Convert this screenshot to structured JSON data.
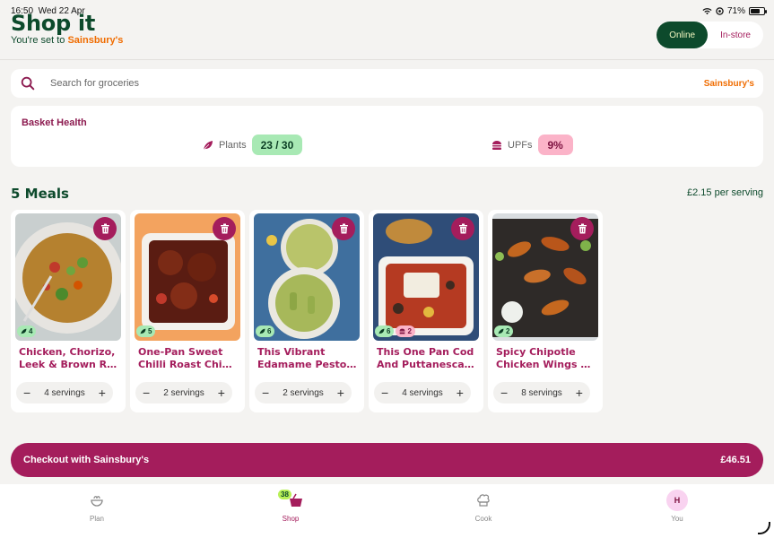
{
  "status": {
    "time": "16:50",
    "date": "Wed 22 Apr",
    "battery": "71%"
  },
  "header": {
    "title": "Shop it",
    "subtitle_prefix": "You're set to",
    "store": "Sainsbury's",
    "toggle": {
      "online": "Online",
      "instore": "In-store"
    }
  },
  "search": {
    "placeholder": "Search for groceries",
    "brand": "Sainsbury's"
  },
  "health": {
    "title": "Basket Health",
    "plants_label": "Plants",
    "plants_value": "23 / 30",
    "upfs_label": "UPFs",
    "upfs_value": "9%"
  },
  "meals": {
    "title": "5 Meals",
    "per_serving": "£2.15 per serving",
    "items": [
      {
        "name1": "Chicken, Chorizo,",
        "name2": "Leek & Brown Ri...",
        "plants": "4",
        "upf": "",
        "servings": "4 servings"
      },
      {
        "name1": "One-Pan Sweet",
        "name2": "Chilli Roast Chic...",
        "plants": "5",
        "upf": "",
        "servings": "2 servings"
      },
      {
        "name1": "This Vibrant",
        "name2": "Edamame Pesto ...",
        "plants": "6",
        "upf": "",
        "servings": "2 servings"
      },
      {
        "name1": "This One Pan Cod",
        "name2": "And Puttanesca ...",
        "plants": "6",
        "upf": "2",
        "servings": "4 servings"
      },
      {
        "name1": "Spicy Chipotle",
        "name2": "Chicken Wings w...",
        "plants": "2",
        "upf": "",
        "servings": "8 servings"
      }
    ]
  },
  "checkout": {
    "label": "Checkout with Sainsbury's",
    "total": "£46.51"
  },
  "tabs": {
    "plan": "Plan",
    "shop": "Shop",
    "shop_count": "38",
    "cook": "Cook",
    "you": "You",
    "avatar_initial": "H"
  },
  "colors": {
    "brand_green": "#0d4a2c",
    "accent": "#a41d5c",
    "store_orange": "#f06c00",
    "plant_green": "#a8e9b4",
    "upf_pink": "#fbb3c8"
  },
  "icons": [
    "search-icon",
    "leaf-icon",
    "burger-icon",
    "trash-icon",
    "bowl-icon",
    "basket-icon",
    "chef-hat-icon",
    "wifi-icon",
    "battery-icon"
  ]
}
